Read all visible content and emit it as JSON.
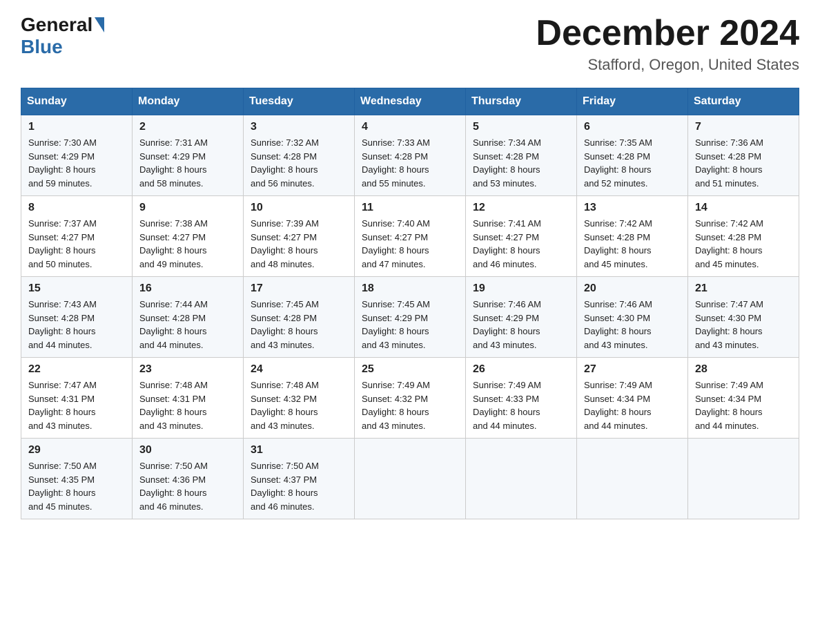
{
  "header": {
    "logo_text_general": "General",
    "logo_text_blue": "Blue",
    "month_title": "December 2024",
    "location": "Stafford, Oregon, United States"
  },
  "weekdays": [
    "Sunday",
    "Monday",
    "Tuesday",
    "Wednesday",
    "Thursday",
    "Friday",
    "Saturday"
  ],
  "weeks": [
    [
      {
        "day": "1",
        "sunrise": "7:30 AM",
        "sunset": "4:29 PM",
        "daylight": "8 hours and 59 minutes."
      },
      {
        "day": "2",
        "sunrise": "7:31 AM",
        "sunset": "4:29 PM",
        "daylight": "8 hours and 58 minutes."
      },
      {
        "day": "3",
        "sunrise": "7:32 AM",
        "sunset": "4:28 PM",
        "daylight": "8 hours and 56 minutes."
      },
      {
        "day": "4",
        "sunrise": "7:33 AM",
        "sunset": "4:28 PM",
        "daylight": "8 hours and 55 minutes."
      },
      {
        "day": "5",
        "sunrise": "7:34 AM",
        "sunset": "4:28 PM",
        "daylight": "8 hours and 53 minutes."
      },
      {
        "day": "6",
        "sunrise": "7:35 AM",
        "sunset": "4:28 PM",
        "daylight": "8 hours and 52 minutes."
      },
      {
        "day": "7",
        "sunrise": "7:36 AM",
        "sunset": "4:28 PM",
        "daylight": "8 hours and 51 minutes."
      }
    ],
    [
      {
        "day": "8",
        "sunrise": "7:37 AM",
        "sunset": "4:27 PM",
        "daylight": "8 hours and 50 minutes."
      },
      {
        "day": "9",
        "sunrise": "7:38 AM",
        "sunset": "4:27 PM",
        "daylight": "8 hours and 49 minutes."
      },
      {
        "day": "10",
        "sunrise": "7:39 AM",
        "sunset": "4:27 PM",
        "daylight": "8 hours and 48 minutes."
      },
      {
        "day": "11",
        "sunrise": "7:40 AM",
        "sunset": "4:27 PM",
        "daylight": "8 hours and 47 minutes."
      },
      {
        "day": "12",
        "sunrise": "7:41 AM",
        "sunset": "4:27 PM",
        "daylight": "8 hours and 46 minutes."
      },
      {
        "day": "13",
        "sunrise": "7:42 AM",
        "sunset": "4:28 PM",
        "daylight": "8 hours and 45 minutes."
      },
      {
        "day": "14",
        "sunrise": "7:42 AM",
        "sunset": "4:28 PM",
        "daylight": "8 hours and 45 minutes."
      }
    ],
    [
      {
        "day": "15",
        "sunrise": "7:43 AM",
        "sunset": "4:28 PM",
        "daylight": "8 hours and 44 minutes."
      },
      {
        "day": "16",
        "sunrise": "7:44 AM",
        "sunset": "4:28 PM",
        "daylight": "8 hours and 44 minutes."
      },
      {
        "day": "17",
        "sunrise": "7:45 AM",
        "sunset": "4:28 PM",
        "daylight": "8 hours and 43 minutes."
      },
      {
        "day": "18",
        "sunrise": "7:45 AM",
        "sunset": "4:29 PM",
        "daylight": "8 hours and 43 minutes."
      },
      {
        "day": "19",
        "sunrise": "7:46 AM",
        "sunset": "4:29 PM",
        "daylight": "8 hours and 43 minutes."
      },
      {
        "day": "20",
        "sunrise": "7:46 AM",
        "sunset": "4:30 PM",
        "daylight": "8 hours and 43 minutes."
      },
      {
        "day": "21",
        "sunrise": "7:47 AM",
        "sunset": "4:30 PM",
        "daylight": "8 hours and 43 minutes."
      }
    ],
    [
      {
        "day": "22",
        "sunrise": "7:47 AM",
        "sunset": "4:31 PM",
        "daylight": "8 hours and 43 minutes."
      },
      {
        "day": "23",
        "sunrise": "7:48 AM",
        "sunset": "4:31 PM",
        "daylight": "8 hours and 43 minutes."
      },
      {
        "day": "24",
        "sunrise": "7:48 AM",
        "sunset": "4:32 PM",
        "daylight": "8 hours and 43 minutes."
      },
      {
        "day": "25",
        "sunrise": "7:49 AM",
        "sunset": "4:32 PM",
        "daylight": "8 hours and 43 minutes."
      },
      {
        "day": "26",
        "sunrise": "7:49 AM",
        "sunset": "4:33 PM",
        "daylight": "8 hours and 44 minutes."
      },
      {
        "day": "27",
        "sunrise": "7:49 AM",
        "sunset": "4:34 PM",
        "daylight": "8 hours and 44 minutes."
      },
      {
        "day": "28",
        "sunrise": "7:49 AM",
        "sunset": "4:34 PM",
        "daylight": "8 hours and 44 minutes."
      }
    ],
    [
      {
        "day": "29",
        "sunrise": "7:50 AM",
        "sunset": "4:35 PM",
        "daylight": "8 hours and 45 minutes."
      },
      {
        "day": "30",
        "sunrise": "7:50 AM",
        "sunset": "4:36 PM",
        "daylight": "8 hours and 46 minutes."
      },
      {
        "day": "31",
        "sunrise": "7:50 AM",
        "sunset": "4:37 PM",
        "daylight": "8 hours and 46 minutes."
      },
      null,
      null,
      null,
      null
    ]
  ],
  "labels": {
    "sunrise": "Sunrise:",
    "sunset": "Sunset:",
    "daylight": "Daylight:"
  }
}
